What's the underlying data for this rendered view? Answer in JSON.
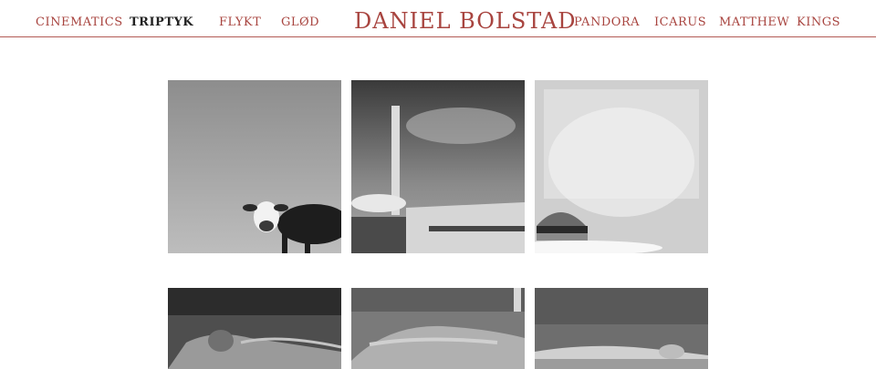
{
  "site": {
    "title": "DANIEL BOLSTAD"
  },
  "nav": {
    "left": [
      "CINEMATICS",
      "TRIPTYK",
      "FLYKT",
      "GLØD"
    ],
    "right": [
      "PANDORA",
      "ICARUS",
      "MATTHEW",
      "KINGS"
    ],
    "active": "TRIPTYK"
  },
  "gallery": {
    "rows": [
      {
        "tiles": [
          "cow-photo",
          "factory-chimney-photo",
          "burger-photo"
        ]
      },
      {
        "tiles": [
          "reclining-man-photo",
          "patient-on-bed-photo",
          "hand-on-bed-photo"
        ]
      }
    ]
  },
  "colors": {
    "accent": "#a8443f",
    "active": "#222222"
  }
}
